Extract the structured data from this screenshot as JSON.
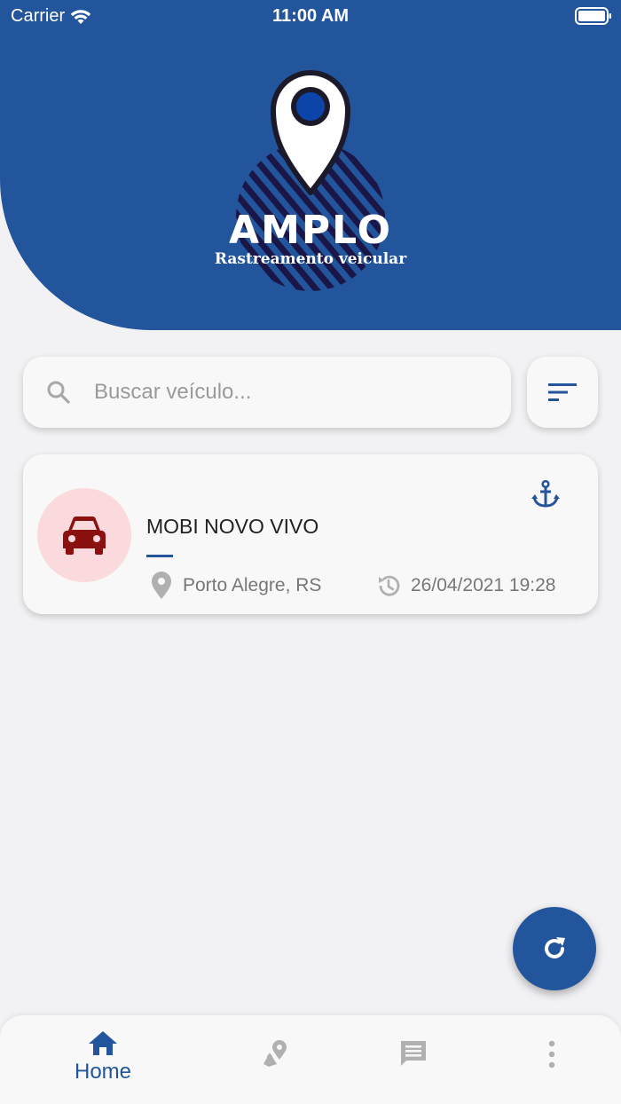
{
  "status_bar": {
    "carrier": "Carrier",
    "time": "11:00 AM"
  },
  "header": {
    "brand": "AMPLO",
    "tagline": "Rastreamento veicular"
  },
  "search": {
    "placeholder": "Buscar veículo..."
  },
  "vehicle": {
    "name": "MOBI NOVO VIVO",
    "location": "Porto Alegre, RS",
    "last_update": "26/04/2021 19:28"
  },
  "bottom_nav": {
    "home_label": "Home"
  },
  "colors": {
    "primary": "#22559b",
    "background": "#f2f2f4",
    "card": "#f8f8f8",
    "vehicle_icon": "#8b1010",
    "vehicle_avatar_bg": "#fadadd",
    "muted_icon": "#b0b0b0"
  },
  "icons": {
    "search": "search-icon",
    "filter": "filter-icon",
    "vehicle": "car-icon",
    "anchor": "anchor-icon",
    "location": "location-pin-icon",
    "clock": "history-clock-icon",
    "refresh": "refresh-icon",
    "home": "home-icon",
    "map": "map-pin-icon",
    "messages": "message-icon",
    "more": "more-vertical-icon"
  }
}
